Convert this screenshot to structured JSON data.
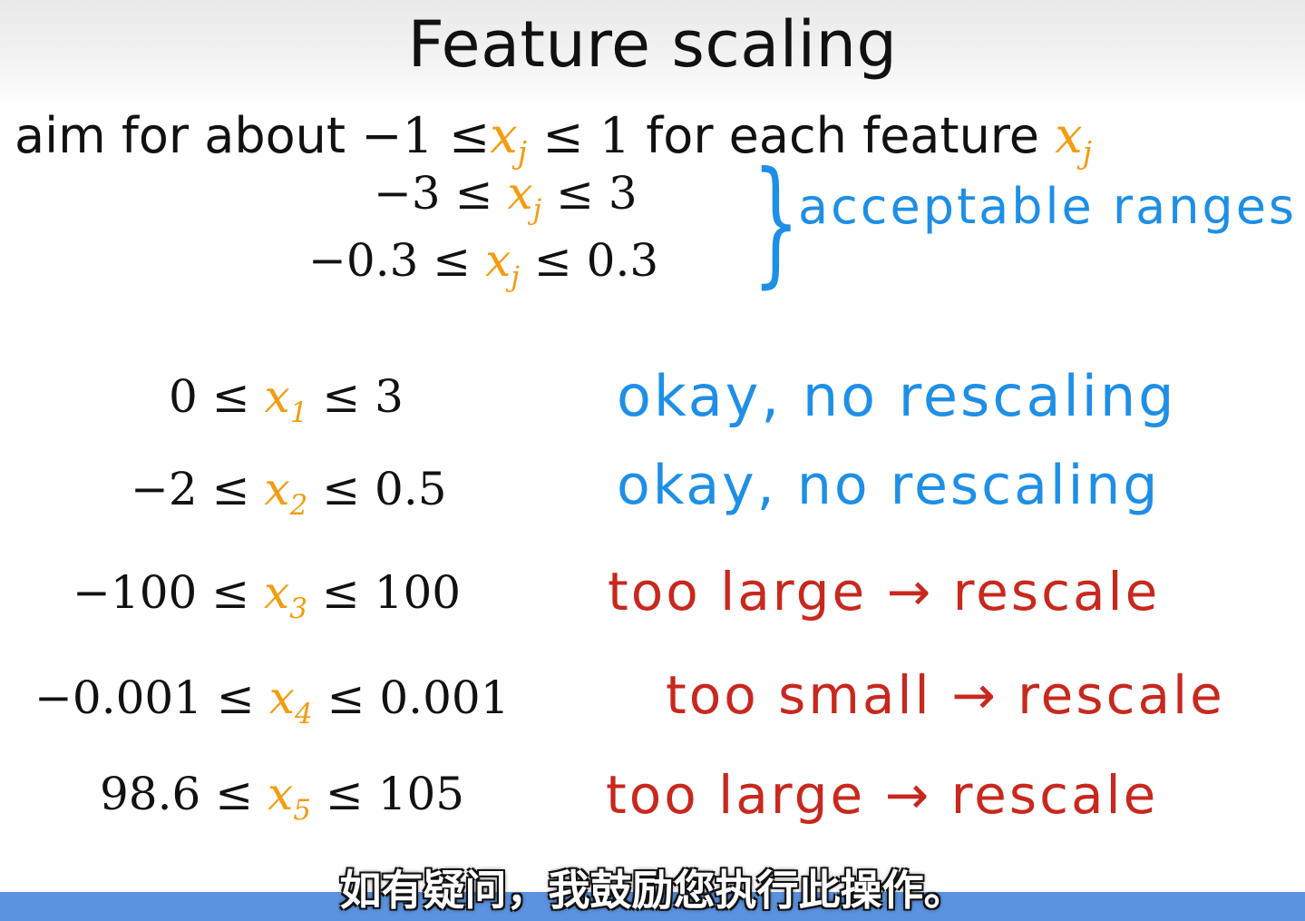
{
  "slide": {
    "title": "Feature scaling",
    "aim": {
      "prefix": "aim for about",
      "range_left": "−1 ≤",
      "var": "x",
      "sub": "j",
      "range_right": "≤ 1",
      "middle": "for each feature",
      "feature_var": "x",
      "feature_sub": "j"
    },
    "acceptable": [
      {
        "left": "−3 ≤",
        "var": "x",
        "sub": "j",
        "right": "≤ 3"
      },
      {
        "left": "−0.3 ≤",
        "var": "x",
        "sub": "j",
        "right": "≤ 0.3"
      }
    ],
    "acceptable_note": "acceptable ranges",
    "examples": [
      {
        "left": "0 ≤",
        "var": "x",
        "sub": "1",
        "right": "≤ 3",
        "note": "okay, no rescaling"
      },
      {
        "left": "−2 ≤",
        "var": "x",
        "sub": "2",
        "right": "≤ 0.5",
        "note": "okay, no rescaling"
      },
      {
        "left": "−100 ≤",
        "var": "x",
        "sub": "3",
        "right": "≤ 100",
        "note": "too large → rescale"
      },
      {
        "left": "−0.001 ≤",
        "var": "x",
        "sub": "4",
        "right": "≤ 0.001",
        "note": "too small → rescale"
      },
      {
        "left": "98.6 ≤",
        "var": "x",
        "sub": "5",
        "right": "≤ 105",
        "note": "too large → rescale"
      }
    ]
  },
  "subtitle": "如有疑问，我鼓励您执行此操作。",
  "colors": {
    "variable": "#f39c12",
    "ok_note": "#1e8fe6",
    "warn_note": "#c8281e",
    "bottom_bar": "#5b93e0"
  }
}
